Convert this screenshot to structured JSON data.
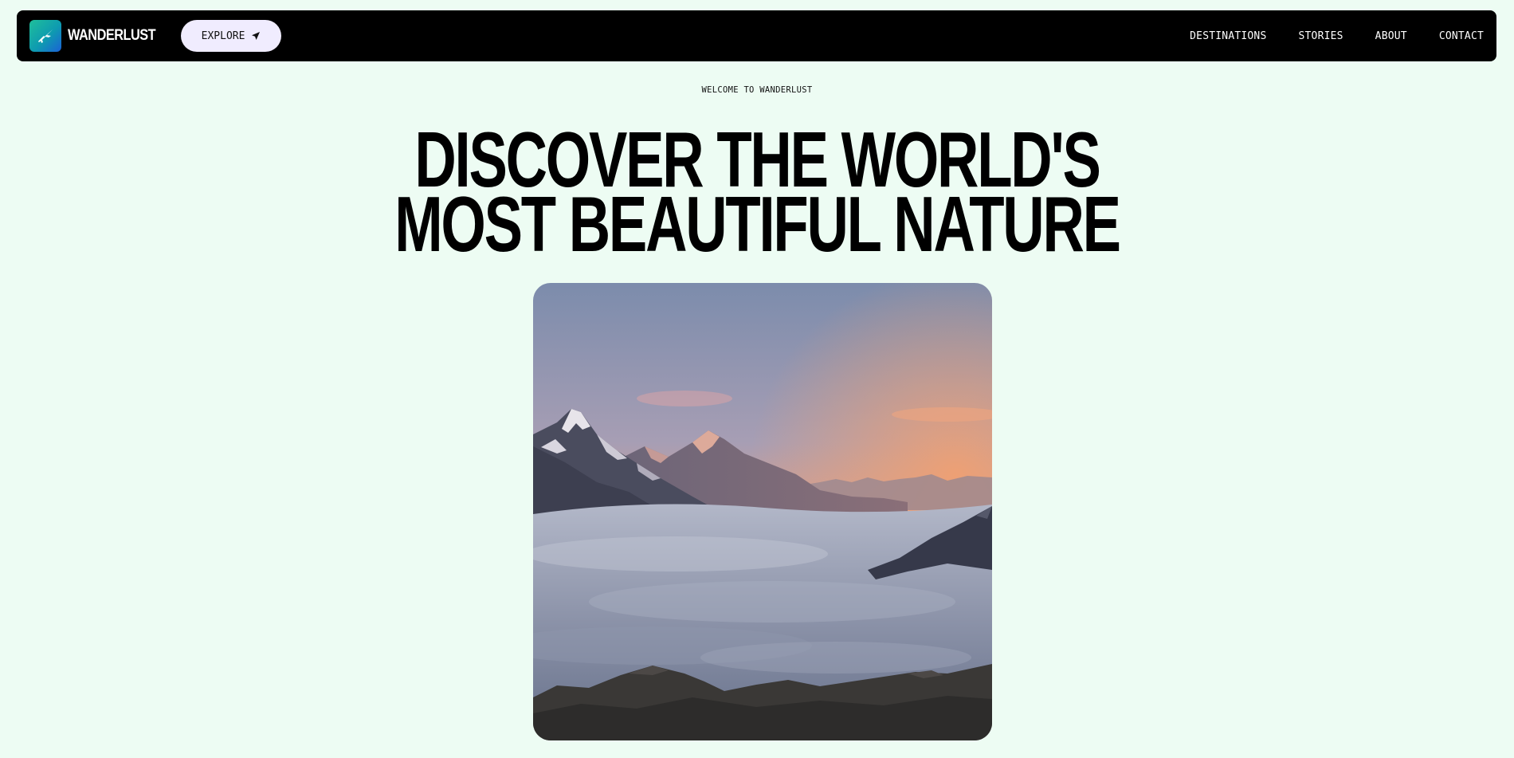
{
  "nav": {
    "logo_icon": "plane-icon",
    "brand": "WANDERLUST",
    "explore_label": "EXPLORE",
    "explore_icon": "send-arrow-icon",
    "links": [
      {
        "label": "DESTINATIONS"
      },
      {
        "label": "STORIES"
      },
      {
        "label": "ABOUT"
      },
      {
        "label": "CONTACT"
      }
    ]
  },
  "hero": {
    "eyebrow": "WELCOME TO WANDERLUST",
    "headline_line1": "DISCOVER THE WORLD'S",
    "headline_line2": "MOST BEAUTIFUL NATURE"
  },
  "colors": {
    "page_background": "#edfcf3",
    "navbar": "#000000",
    "explore_button": "#f0ecfe",
    "logo_gradient_start": "#1fbf9a",
    "logo_gradient_end": "#1b62d6"
  }
}
